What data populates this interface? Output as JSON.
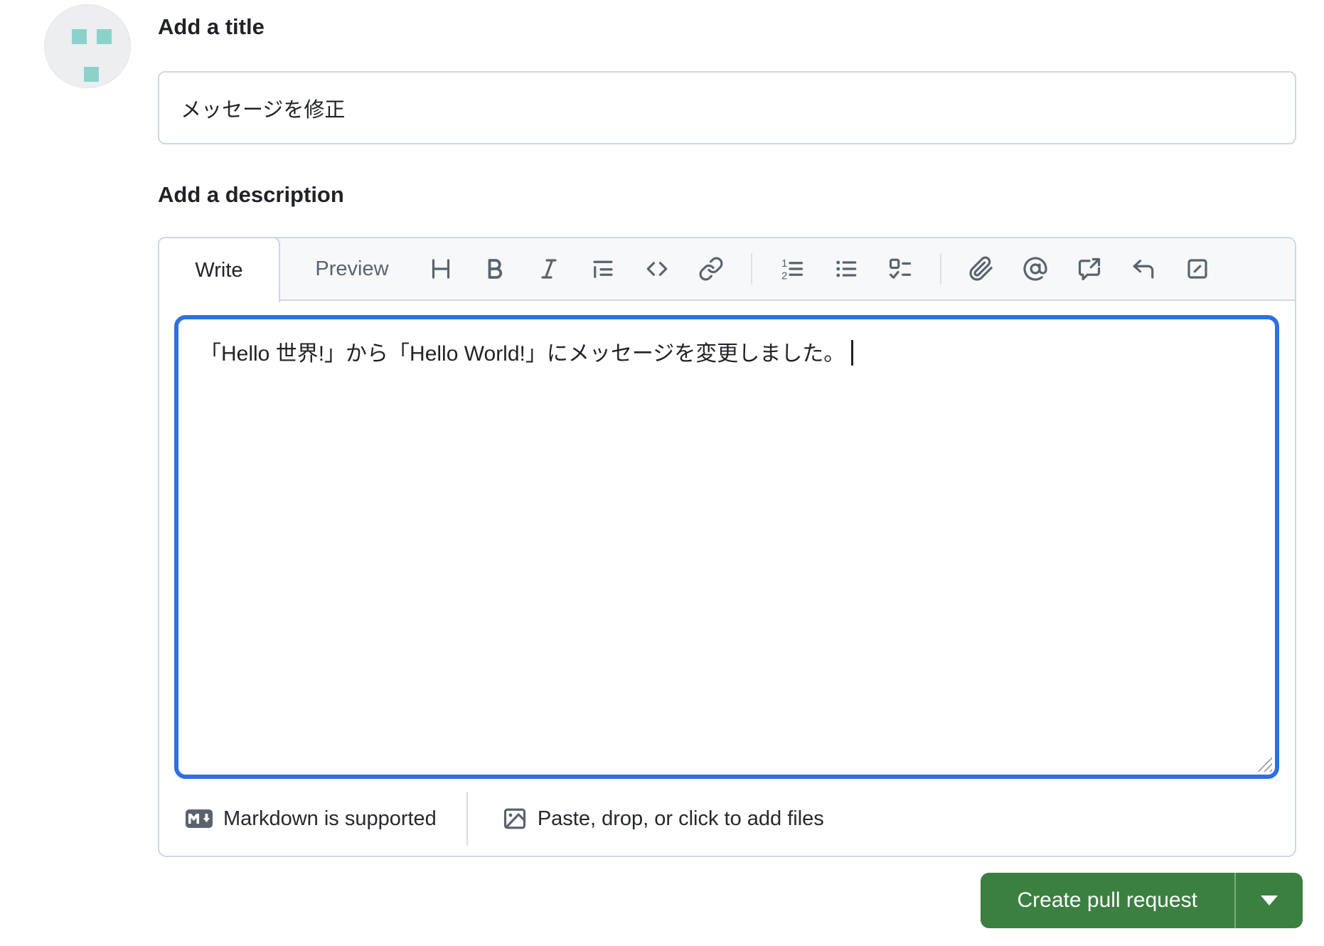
{
  "avatar": {
    "background": "#eceef0",
    "square_color": "#8bd2cb",
    "pattern": "identicon-three-squares"
  },
  "title_section": {
    "heading": "Add a title",
    "value": "メッセージを修正"
  },
  "description_section": {
    "heading": "Add a description",
    "tabs": [
      {
        "label": "Write",
        "active": true
      },
      {
        "label": "Preview",
        "active": false
      }
    ],
    "toolbar_icons": [
      "heading",
      "bold",
      "italic",
      "quote",
      "code",
      "link",
      "ordered-list",
      "unordered-list",
      "task-list",
      "attach-file",
      "mention",
      "cross-reference",
      "reply",
      "slash-command"
    ],
    "editor_value": "「Hello 世界!」から「Hello World!」にメッセージを変更しました。",
    "cursor_visible": true,
    "footer": {
      "markdown_note": "Markdown is supported",
      "attach_note": "Paste, drop, or click to add files"
    }
  },
  "actions": {
    "create_pull_request": "Create pull request"
  },
  "colors": {
    "accent_green": "#3b8041",
    "focus_blue": "#2f6fe0",
    "border_gray": "#d0d7de",
    "icon_gray": "#59636e",
    "text_dark": "#1f2328",
    "tab_header_bg": "#f6f8fa"
  }
}
